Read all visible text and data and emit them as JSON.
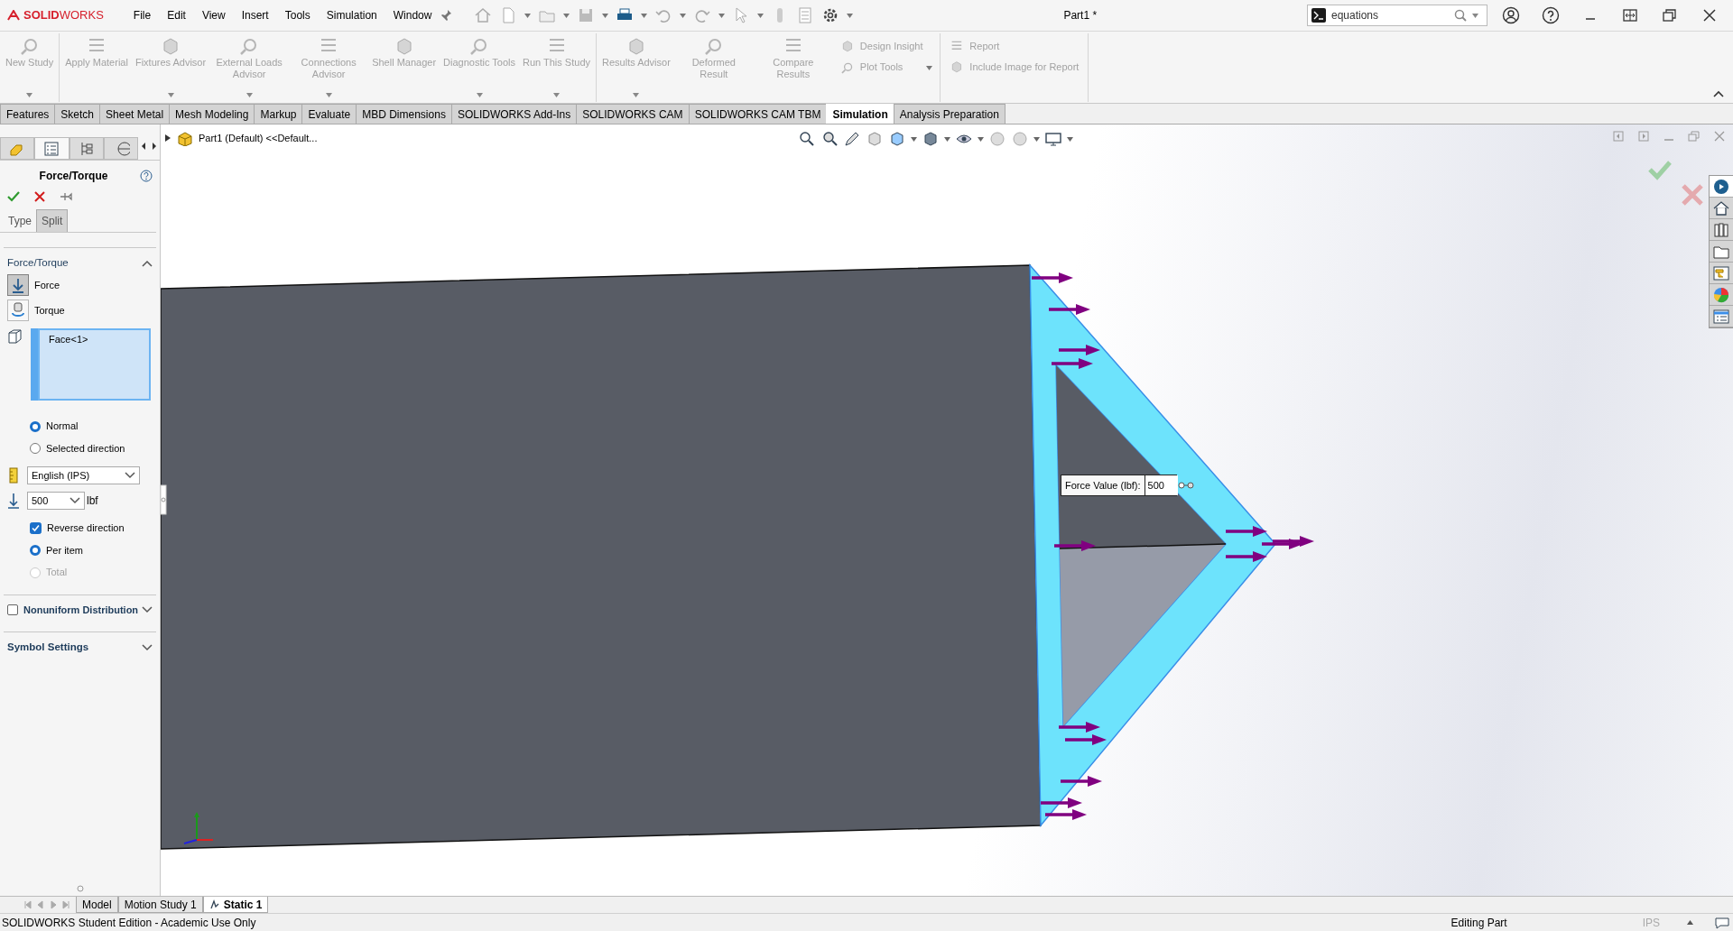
{
  "app": {
    "logo": "**SOLID**WORKS"
  },
  "menu": [
    "File",
    "Edit",
    "View",
    "Insert",
    "Tools",
    "Simulation",
    "Window"
  ],
  "window": {
    "title": "Part1 *"
  },
  "search": {
    "value": "equations"
  },
  "ribbon": {
    "groups": [
      {
        "items": [
          {
            "kind": "large",
            "label": "New Study",
            "dropdown": true,
            "disabled": true
          }
        ]
      },
      {
        "items": [
          {
            "kind": "large",
            "label": "Apply Material",
            "dropdown": false,
            "disabled": true
          },
          {
            "kind": "large",
            "label": "Fixtures Advisor",
            "dropdown": true,
            "disabled": true
          },
          {
            "kind": "large",
            "label": "External Loads Advisor",
            "dropdown": true,
            "disabled": true
          },
          {
            "kind": "large",
            "label": "Connections Advisor",
            "dropdown": true,
            "disabled": true
          },
          {
            "kind": "large",
            "label": "Shell Manager",
            "dropdown": false,
            "disabled": true
          },
          {
            "kind": "large",
            "label": "Diagnostic Tools",
            "dropdown": true,
            "disabled": true
          },
          {
            "kind": "large",
            "label": "Run This Study",
            "dropdown": true,
            "disabled": true
          }
        ]
      },
      {
        "items": [
          {
            "kind": "large",
            "label": "Results Advisor",
            "dropdown": true,
            "disabled": true
          },
          {
            "kind": "large",
            "label": "Deformed Result",
            "dropdown": false,
            "disabled": true
          },
          {
            "kind": "large",
            "label": "Compare Results",
            "dropdown": false,
            "disabled": true
          },
          {
            "kind": "small",
            "label": "Design Insight",
            "dropdown": false,
            "disabled": true
          },
          {
            "kind": "small",
            "label": "Plot Tools",
            "dropdown": true,
            "disabled": true
          }
        ]
      },
      {
        "items": [
          {
            "kind": "small",
            "label": "Report",
            "dropdown": false,
            "disabled": true
          },
          {
            "kind": "small",
            "label": "Include Image for Report",
            "dropdown": false,
            "disabled": true
          }
        ]
      }
    ]
  },
  "command_tabs": [
    {
      "label": "Features",
      "selected": false
    },
    {
      "label": "Sketch",
      "selected": false
    },
    {
      "label": "Sheet Metal",
      "selected": false
    },
    {
      "label": "Mesh Modeling",
      "selected": false
    },
    {
      "label": "Markup",
      "selected": false
    },
    {
      "label": "Evaluate",
      "selected": false
    },
    {
      "label": "MBD Dimensions",
      "selected": false
    },
    {
      "label": "SOLIDWORKS Add-Ins",
      "selected": false
    },
    {
      "label": "SOLIDWORKS CAM",
      "selected": false
    },
    {
      "label": "SOLIDWORKS CAM TBM",
      "selected": false
    },
    {
      "label": "Simulation",
      "selected": true
    },
    {
      "label": "Analysis Preparation",
      "selected": false
    }
  ],
  "property_manager": {
    "title": "Force/Torque",
    "tabs": [
      {
        "label": "Type",
        "selected": true
      },
      {
        "label": "Split",
        "selected": false
      }
    ],
    "section": {
      "title": "Force/Torque",
      "expanded": true
    },
    "load_types": [
      {
        "label": "Force",
        "selected": true
      },
      {
        "label": "Torque",
        "selected": false
      }
    ],
    "selection": "Face<1>",
    "direction": [
      {
        "label": "Normal",
        "selected": true
      },
      {
        "label": "Selected direction",
        "selected": false
      }
    ],
    "units": "English (IPS)",
    "force_value": "500",
    "force_unit": "lbf",
    "options": [
      {
        "kind": "checkbox",
        "label": "Reverse direction",
        "checked": true,
        "disabled": false
      },
      {
        "kind": "radio",
        "label": "Per item",
        "selected": true,
        "disabled": false
      },
      {
        "kind": "radio",
        "label": "Total",
        "selected": false,
        "disabled": true
      }
    ],
    "sections": [
      {
        "kind": "checkbox",
        "title": "Nonuniform Distribution",
        "checked": false,
        "expanded": false
      },
      {
        "kind": "plain",
        "title": "Symbol Settings",
        "expanded": false
      }
    ]
  },
  "panel_tabs": [
    {
      "selected": false
    },
    {
      "selected": true
    },
    {
      "selected": false
    },
    {
      "selected": false
    }
  ],
  "task_pane": [
    {
      "selected": true
    },
    {
      "selected": false
    },
    {
      "selected": false
    },
    {
      "selected": false
    },
    {
      "selected": false
    },
    {
      "selected": false
    },
    {
      "selected": false
    }
  ],
  "feature_tree": {
    "root": "Part1 (Default) <<Default..."
  },
  "force_popup": {
    "label": "Force Value (lbf):",
    "value": "500"
  },
  "model_tabs": [
    {
      "label": "Model",
      "selected": false
    },
    {
      "label": "Motion Study 1",
      "selected": false
    },
    {
      "label": "Static 1",
      "selected": true
    }
  ],
  "status_bar": {
    "text": "SOLIDWORKS Student Edition - Academic Use Only",
    "mode": "Editing Part",
    "units": "IPS"
  }
}
